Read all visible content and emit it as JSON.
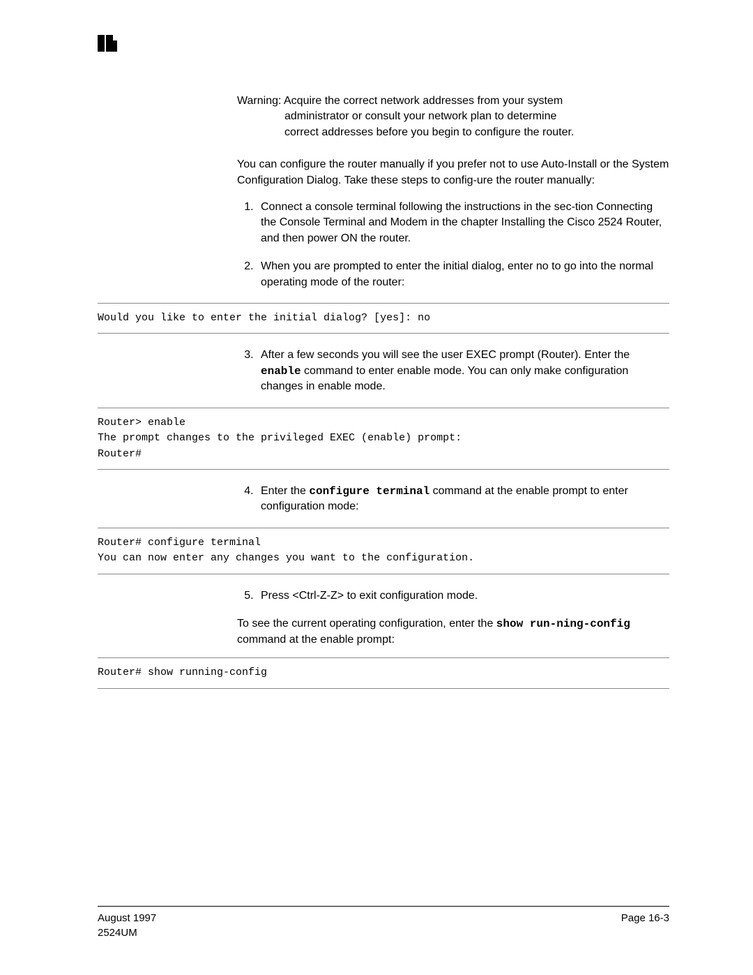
{
  "header": {
    "mid_glyph": "",
    "right_glyph": ""
  },
  "warning": {
    "label": "Warning:",
    "line1": " Acquire the correct network addresses from your system",
    "line2": "administrator or consult your network plan to determine",
    "line3": "correct addresses before you begin to configure the router."
  },
  "section_mark": "",
  "intro": "You can configure the router manually if you prefer not to use Auto-Install or the System Configuration Dialog. Take these steps to config-ure the router manually:",
  "steps_a": {
    "s1": "Connect a console terminal following the instructions in the sec-tion Connecting the Console Terminal and Modem in the chapter Installing the Cisco 2524 Router, and then power ON the router.",
    "s2": "When you are prompted to enter the initial dialog, enter no to go into the normal operating mode of the router:"
  },
  "code1": "Would you like to enter the initial dialog? [yes]: no",
  "steps_b": {
    "s3_a": "After a few seconds you will see the user EXEC prompt (Router). Enter the ",
    "s3_cmd": "enable",
    "s3_b": " command to enter enable mode. You can only make configuration changes in enable mode."
  },
  "code2": "Router> enable\nThe prompt changes to the privileged EXEC (enable) prompt:\nRouter#",
  "steps_c": {
    "s4_a": "Enter the ",
    "s4_cmd": "configure terminal",
    "s4_b": " command at the enable prompt to enter configuration mode:"
  },
  "code3": "Router# configure terminal\nYou can now enter any changes you want to the configuration.",
  "steps_d": {
    "s5": "Press <Ctrl-Z-Z> to exit configuration mode."
  },
  "tail": {
    "a": "To see the current operating configuration, enter the ",
    "cmd": "show run-ning-config",
    "b": " command at the enable prompt:"
  },
  "code4": "Router# show running-config",
  "footer": {
    "date": "August 1997",
    "doc": "2524UM",
    "page": "Page 16-3"
  }
}
